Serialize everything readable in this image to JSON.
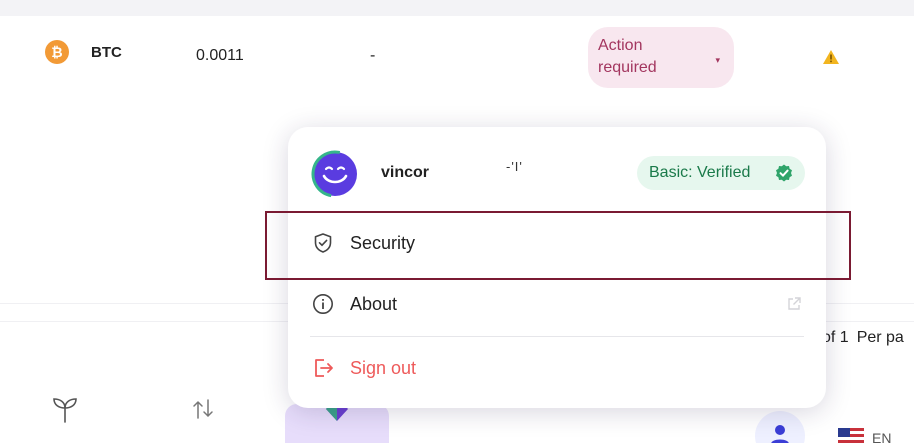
{
  "asset_row": {
    "symbol": "BTC",
    "icon": "bitcoin-icon",
    "amount": "0.0011",
    "value": "-",
    "status_line1": "Action",
    "status_line2": "required",
    "status_caret": "▾",
    "status_color": "#a3365f",
    "warning_icon": "warning-icon"
  },
  "pagination": {
    "text": "of 1",
    "per_page": "Per pa"
  },
  "menu": {
    "username": "vincor",
    "username_garble": "-'I'",
    "verified_label": "Basic: Verified",
    "verified_color": "#1a7a4a",
    "items": [
      {
        "label": "Security",
        "icon": "shield-check-icon"
      },
      {
        "label": "About",
        "icon": "info-icon",
        "trailing_icon": "external-link-icon"
      },
      {
        "label": "Sign out",
        "icon": "sign-out-icon"
      }
    ]
  },
  "bottom_nav": {
    "language": "EN",
    "items": [
      "sprout-icon",
      "swap-icon",
      "diamond-logo-icon",
      "user-icon",
      "us-flag-icon"
    ],
    "active_color": "#e7ddfb"
  }
}
